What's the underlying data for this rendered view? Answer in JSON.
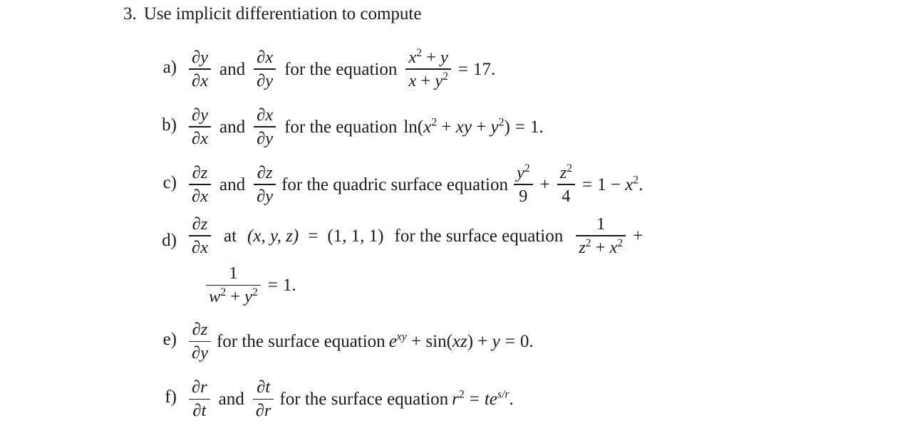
{
  "document": {
    "type": "math-homework-problem",
    "background_color": "#ffffff",
    "text_color": "#1a1a1a"
  },
  "problem": {
    "number": "3.",
    "statement": "Use implicit differentiation to compute"
  },
  "connectors": {
    "and": "and",
    "for_the_equation": "for the equation",
    "for_the_quadric_surface_equation": "for the quadric surface equation",
    "for_the_surface_equation": "for the surface equation",
    "at": "at",
    "equals": "=",
    "plus": "+",
    "minus": "−"
  },
  "parts": [
    {
      "label": "a)",
      "derivative_1": {
        "numerator": "∂y",
        "denominator": "∂x"
      },
      "derivative_2": {
        "numerator": "∂x",
        "denominator": "∂y"
      },
      "connector": "for the equation",
      "equation": {
        "fraction": {
          "numerator": "x² + y",
          "denominator": "x + y²"
        },
        "rhs": "17."
      }
    },
    {
      "label": "b)",
      "derivative_1": {
        "numerator": "∂y",
        "denominator": "∂x"
      },
      "derivative_2": {
        "numerator": "∂x",
        "denominator": "∂y"
      },
      "connector": "for the equation",
      "equation": {
        "lhs": "ln(x² + xy + y²)",
        "rhs": "1."
      }
    },
    {
      "label": "c)",
      "derivative_1": {
        "numerator": "∂z",
        "denominator": "∂x"
      },
      "derivative_2": {
        "numerator": "∂z",
        "denominator": "∂y"
      },
      "connector": "for the quadric surface equation",
      "equation": {
        "term_1": {
          "numerator": "y²",
          "denominator": "9"
        },
        "term_2": {
          "numerator": "z²",
          "denominator": "4"
        },
        "rhs": "1 − x²."
      }
    },
    {
      "label": "d)",
      "derivative_1": {
        "numerator": "∂z",
        "denominator": "∂x"
      },
      "at_text": "at",
      "point_lhs": "(x, y, z)",
      "point_rhs": "(1, 1, 1)",
      "connector": "for the surface equation",
      "equation": {
        "term_1": {
          "numerator": "1",
          "denominator": "z² + x²"
        },
        "term_2": {
          "numerator": "1",
          "denominator": "w² + y²"
        },
        "rhs": "1."
      }
    },
    {
      "label": "e)",
      "derivative_1": {
        "numerator": "∂z",
        "denominator": "∂y"
      },
      "connector": "for the surface equation",
      "equation": {
        "lhs": "e^{xy} + sin(xz) + y",
        "rhs": "0."
      }
    },
    {
      "label": "f)",
      "derivative_1": {
        "numerator": "∂r",
        "denominator": "∂t"
      },
      "derivative_2": {
        "numerator": "∂t",
        "denominator": "∂r"
      },
      "connector": "for the surface equation",
      "equation": {
        "lhs": "r²",
        "rhs": "te^{s/r}."
      }
    }
  ],
  "symbols": {
    "partial": "∂",
    "x": "x",
    "y": "y",
    "z": "z",
    "w": "w",
    "r": "r",
    "t": "t",
    "s": "s",
    "two": "2",
    "nine": "9",
    "four": "4",
    "one": "1",
    "seventeen": "17.",
    "one_period": "1.",
    "zero_period": "0.",
    "ln": "ln",
    "sin": "sin",
    "e": "e",
    "paren_open": "(",
    "paren_close": ")",
    "slash": "/",
    "period": "."
  }
}
